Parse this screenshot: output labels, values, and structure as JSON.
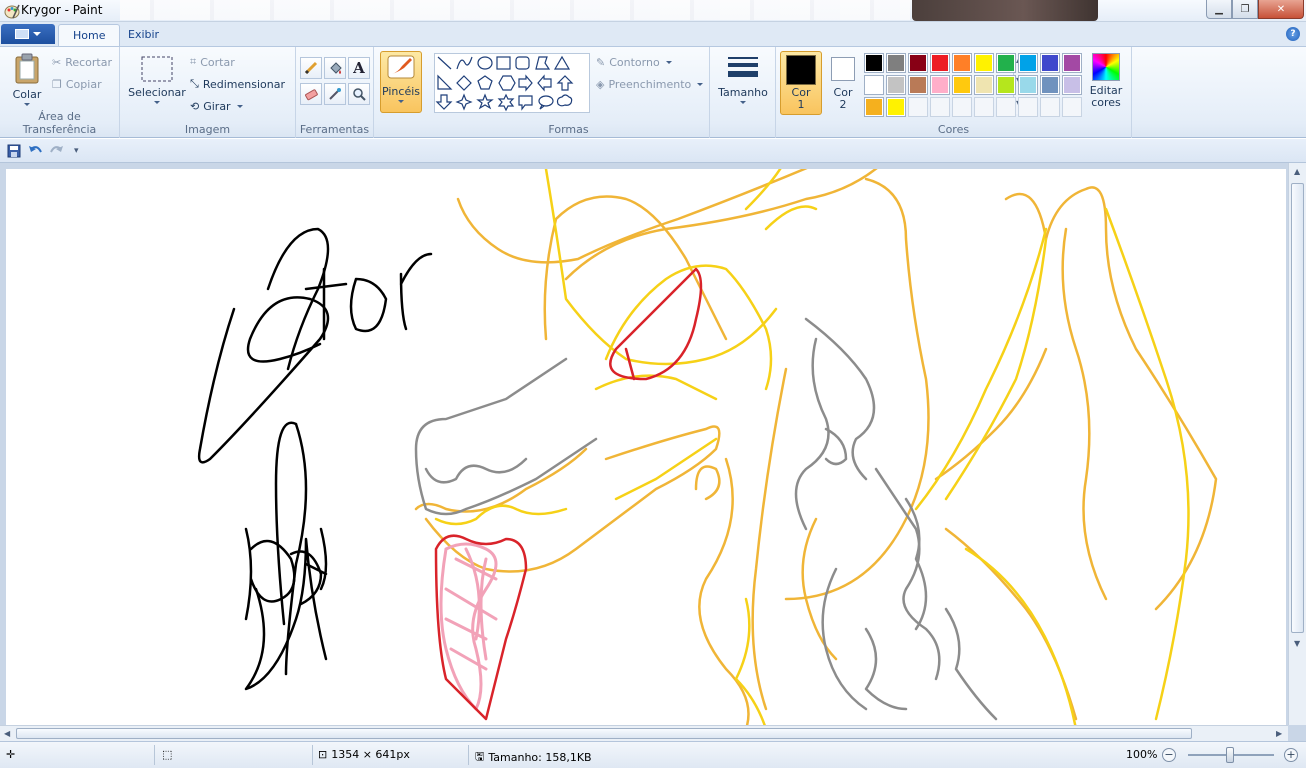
{
  "window": {
    "title": "Krygor - Paint"
  },
  "tabs": [
    {
      "label": "Home",
      "active": true
    },
    {
      "label": "Exibir",
      "active": false
    }
  ],
  "clipboard": {
    "paste": "Colar",
    "cut": "Recortar",
    "copy": "Copiar",
    "group_label": "Área de Transferência"
  },
  "image": {
    "select": "Selecionar",
    "crop": "Cortar",
    "resize": "Redimensionar",
    "rotate": "Girar",
    "group_label": "Imagem"
  },
  "tools": {
    "group_label": "Ferramentas"
  },
  "brushes": {
    "label": "Pincéis"
  },
  "shapes": {
    "outline": "Contorno",
    "fill": "Preenchimento",
    "group_label": "Formas"
  },
  "size": {
    "label": "Tamanho"
  },
  "colors": {
    "color1_label": "Cor 1",
    "color2_label": "Cor 2",
    "color1": "#000000",
    "color2": "#ffffff",
    "edit_label": "Editar cores",
    "group_label": "Cores",
    "palette": [
      "#000000",
      "#7f7f7f",
      "#880015",
      "#ed1c24",
      "#ff7f27",
      "#fff200",
      "#22b14c",
      "#00a2e8",
      "#3f48cc",
      "#a349a4",
      "#ffffff",
      "#c3c3c3",
      "#b97a57",
      "#ffaec9",
      "#ffc90e",
      "#efe4b0",
      "#b5e61d",
      "#99d9ea",
      "#7092be",
      "#c8bfe7",
      "#f5b01e",
      "#fff200",
      "",
      "",
      "",
      "",
      "",
      "",
      "",
      ""
    ]
  },
  "canvas": {
    "stroke_colors": {
      "black": "#000000",
      "gold": "#f0b537",
      "yellow": "#f6d117",
      "gray": "#8c8c8c",
      "red": "#d9232a",
      "pink": "#f2a2b8"
    }
  },
  "status": {
    "dimensions": "1354 × 641px",
    "size": "Tamanho: 158,1KB",
    "zoom": "100%"
  }
}
